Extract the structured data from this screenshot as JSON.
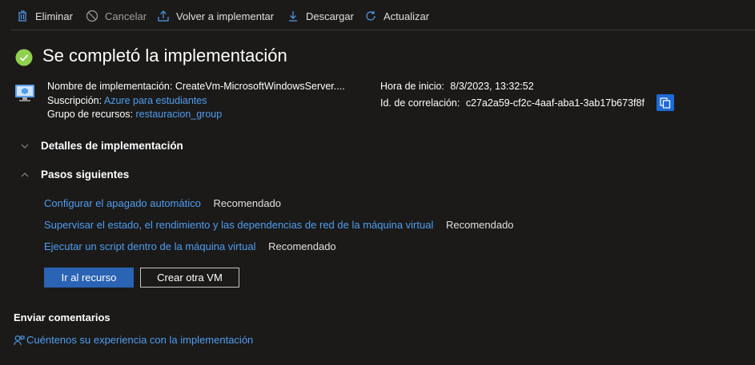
{
  "toolbar": {
    "delete_label": "Eliminar",
    "cancel_label": "Cancelar",
    "redeploy_label": "Volver a implementar",
    "download_label": "Descargar",
    "refresh_label": "Actualizar"
  },
  "header": {
    "title": "Se completó la implementación",
    "status": "success"
  },
  "details": {
    "deployment_name_label": "Nombre de implementación:",
    "deployment_name_value": "CreateVm-MicrosoftWindowsServer....",
    "subscription_label": "Suscripción:",
    "subscription_value": "Azure para estudiantes",
    "resource_group_label": "Grupo de recursos:",
    "resource_group_value": "restauracion_group",
    "start_time_label": "Hora de inicio:",
    "start_time_value": "8/3/2023, 13:32:52",
    "correlation_id_label": "Id. de correlación:",
    "correlation_id_value": "c27a2a59-cf2c-4aaf-aba1-3ab17b673f8f"
  },
  "sections": {
    "deployment_details": "Detalles de implementación",
    "next_steps": "Pasos siguientes"
  },
  "next_steps": [
    {
      "label": "Configurar el apagado automático",
      "tag": "Recomendado"
    },
    {
      "label": "Supervisar el estado, el rendimiento y las dependencias de red de la máquina virtual",
      "tag": "Recomendado"
    },
    {
      "label": "Ejecutar un script dentro de la máquina virtual",
      "tag": "Recomendado"
    }
  ],
  "actions": {
    "go_to_resource": "Ir al recurso",
    "create_another_vm": "Crear otra VM"
  },
  "feedback": {
    "title": "Enviar comentarios",
    "link": "Cuéntenos su experiencia con la implementación"
  },
  "colors": {
    "background": "#1b1a19",
    "link": "#4f9df0",
    "primary_button": "#2b63b5",
    "success": "#8fd14f"
  }
}
